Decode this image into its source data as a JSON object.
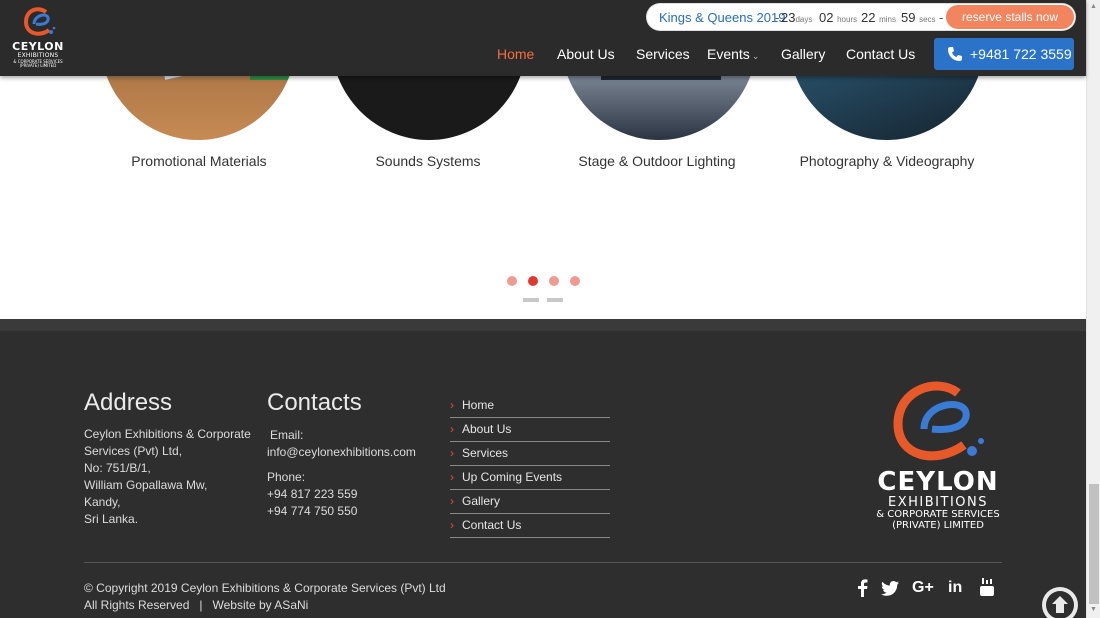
{
  "brand": {
    "l1": "CEYLON",
    "l2": "EXHIBITIONS",
    "l3": "& CORPORATE SERVICES",
    "l4": "(PRIVATE) LIMITED"
  },
  "promo": {
    "event": "Kings & Queens 2019",
    "days": "23",
    "days_label": "days",
    "hours": "02",
    "hours_label": "hours",
    "mins": "22",
    "mins_label": "mins",
    "secs": "59",
    "secs_label": "secs",
    "cta": "reserve stalls now"
  },
  "nav": [
    "Home",
    "About Us",
    "Services",
    "Events",
    "Gallery",
    "Contact Us"
  ],
  "phone": "+9481 722 3559",
  "services": [
    "Promotional Materials",
    "Sounds Systems",
    "Stage & Outdoor Lighting",
    "Photography & Videography"
  ],
  "footer": {
    "address_title": "Address",
    "address_lines": [
      "Ceylon Exhibitions & Corporate",
      "Services (Pvt) Ltd,",
      "No: 751/B/1,",
      "William Gopallawa Mw,",
      "Kandy,",
      "Sri Lanka."
    ],
    "contacts_title": "Contacts",
    "email_label": "Email:",
    "email": "info@ceylonexhibitions.com",
    "phone_label": "Phone:",
    "phones": [
      "+94 817 223 559",
      "+94 774 750 550"
    ],
    "links": [
      "Home",
      "About Us",
      "Services",
      "Up Coming Events",
      "Gallery",
      "Contact Us"
    ],
    "copyright": "© Copyright 2019 Ceylon Exhibitions & Corporate Services (Pvt) Ltd",
    "rights": "All Rights Reserved   |   Website by ASaNi"
  },
  "colors": {
    "accent": "#f36f3f",
    "phone_blue": "#2a73c8",
    "footer_bg": "#2e2e2e"
  }
}
